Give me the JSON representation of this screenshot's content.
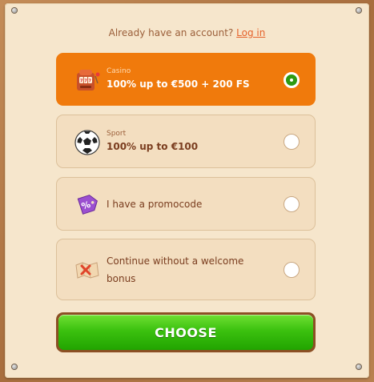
{
  "login": {
    "prompt": "Already have an account?",
    "link": "Log in"
  },
  "options": [
    {
      "icon": "slot-machine-icon",
      "category": "Casino",
      "title": "100% up to €500 + 200 FS",
      "selected": true
    },
    {
      "icon": "soccer-ball-icon",
      "category": "Sport",
      "title": "100% up to €100",
      "selected": false
    },
    {
      "icon": "percent-tag-icon",
      "title": "I have a promocode",
      "selected": false
    },
    {
      "icon": "crossed-map-icon",
      "title_line1": "Continue without a welcome",
      "title_line2": "bonus",
      "selected": false
    }
  ],
  "choose_button": {
    "label": "CHOOSE"
  },
  "colors": {
    "selected_bg": "#f07a0c",
    "option_bg": "#f3dec0",
    "button_green": "#3bc10f",
    "text_brown": "#7a3d1f",
    "link_orange": "#e5622b"
  }
}
